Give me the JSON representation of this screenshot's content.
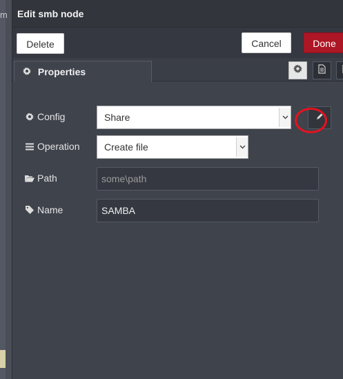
{
  "background": {
    "edge_char": "m"
  },
  "tray": {
    "title": "Edit smb node",
    "toolbar": {
      "delete_label": "Delete",
      "cancel_label": "Cancel",
      "done_label": "Done"
    },
    "tabs": {
      "properties_label": "Properties",
      "icons": [
        "gear-icon",
        "document-icon",
        "flag-icon"
      ]
    },
    "form": {
      "config": {
        "label": "Config",
        "value": "Share"
      },
      "operation": {
        "label": "Operation",
        "value": "Create file"
      },
      "path": {
        "label": "Path",
        "placeholder": "some\\path",
        "value": ""
      },
      "name": {
        "label": "Name",
        "value": "SAMBA"
      }
    }
  },
  "colors": {
    "done_button": "#ad1625",
    "highlight_ring": "#e8111e",
    "tray_background": "#3f434c"
  }
}
